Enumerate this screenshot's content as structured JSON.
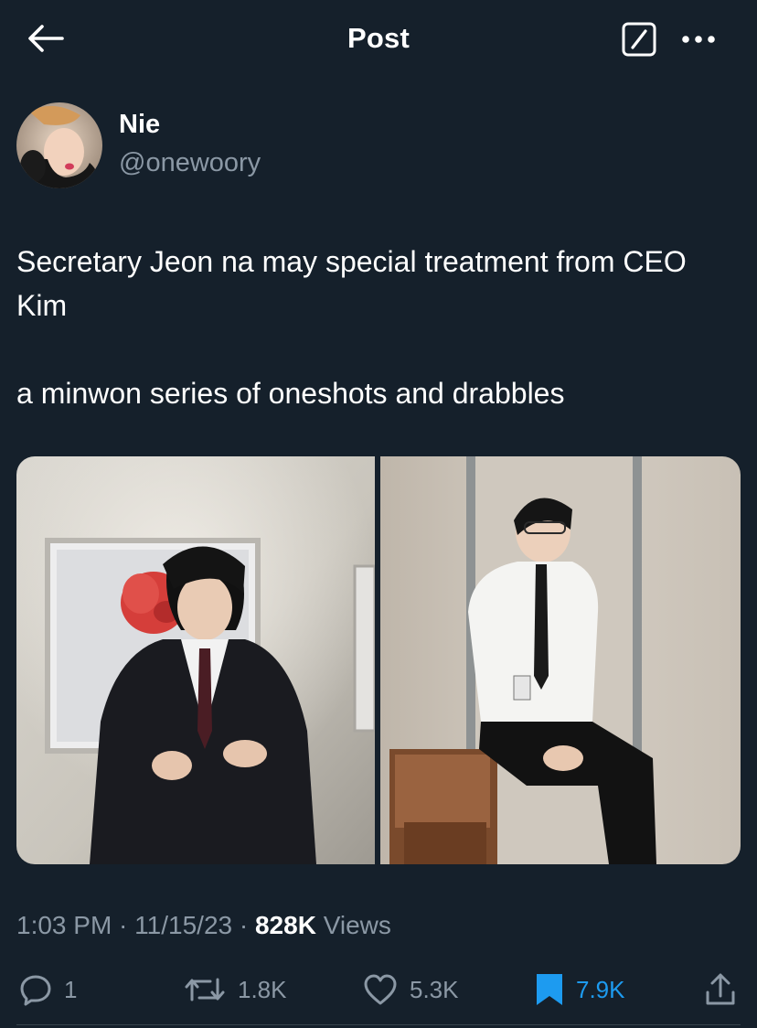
{
  "header": {
    "title": "Post",
    "back_icon": "arrow-left-icon",
    "grok_icon": "grok-icon",
    "more_icon": "more-dots-icon"
  },
  "author": {
    "display_name": "Nie",
    "handle": "@onewoory"
  },
  "tweet": {
    "line1": "Secretary Jeon na may special treatment from CEO Kim",
    "line2": "a minwon series of oneshots and drabbles"
  },
  "meta": {
    "time": "1:03 PM",
    "sep1": " · ",
    "date": "11/15/23",
    "sep2": " · ",
    "views_count": "828K",
    "views_label": " Views"
  },
  "actions": {
    "reply_count": "1",
    "retweet_count": "1.8K",
    "like_count": "5.3K",
    "bookmark_count": "7.9K"
  },
  "colors": {
    "background": "#15202b",
    "secondary_text": "#8b98a5",
    "accent": "#1d9bf0"
  }
}
